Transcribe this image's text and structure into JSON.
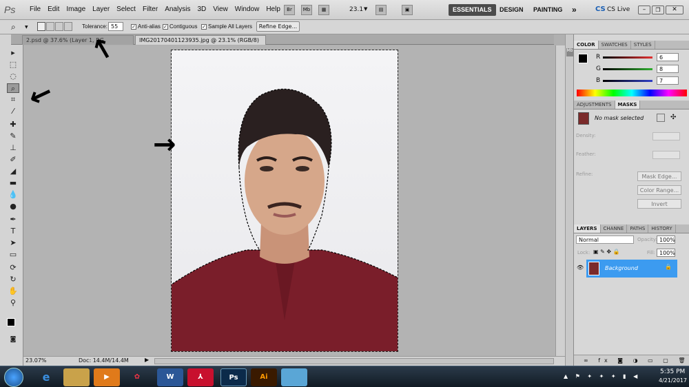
{
  "app": {
    "logo": "Ps"
  },
  "menu": [
    "File",
    "Edit",
    "Image",
    "Layer",
    "Select",
    "Filter",
    "Analysis",
    "3D",
    "View",
    "Window",
    "Help"
  ],
  "appbar": {
    "zoom": "23.1",
    "workspaces": [
      "ESSENTIALS",
      "DESIGN",
      "PAINTING"
    ],
    "more": "»",
    "cslive": "CS Live"
  },
  "options": {
    "tolerance_label": "Tolerance:",
    "tolerance_value": "55",
    "antialias": "Anti-alias",
    "contiguous": "Contiguous",
    "sample_all": "Sample All Layers",
    "refine_edge": "Refine Edge..."
  },
  "tabs": [
    {
      "label": "2.psd @ 37.6% (Layer 1, RG"
    },
    {
      "label": "IMG20170401123935.jpg @ 23.1% (RGB/8) *",
      "close": "×"
    }
  ],
  "status": {
    "zoom": "23.07%",
    "doc": "Doc: 14.4M/14.4M"
  },
  "color_panel": {
    "tabs": [
      "COLOR",
      "SWATCHES",
      "STYLES"
    ],
    "channels": [
      {
        "label": "R",
        "value": "6",
        "color": "#e23030"
      },
      {
        "label": "G",
        "value": "8",
        "color": "#2fae2f"
      },
      {
        "label": "B",
        "value": "7",
        "color": "#2f3fc8"
      }
    ]
  },
  "masks_panel": {
    "tabs": [
      "ADJUSTMENTS",
      "MASKS"
    ],
    "status": "No mask selected",
    "density": "Density:",
    "feather": "Feather:",
    "refine": "Refine:",
    "buttons": [
      "Mask Edge...",
      "Color Range...",
      "Invert"
    ]
  },
  "layers_panel": {
    "tabs": [
      "LAYERS",
      "CHANNE",
      "PATHS",
      "HISTORY"
    ],
    "blend": "Normal",
    "opacity_label": "Opacity:",
    "opacity": "100%",
    "lock_label": "Lock:",
    "fill_label": "Fill:",
    "fill": "100%",
    "layer_name": "Background"
  },
  "taskbar": {
    "time": "5:35 PM",
    "date": "4/21/2017"
  },
  "colors": {
    "accent": "#3c9bf0",
    "workspace_active": "#4b4b4b"
  }
}
